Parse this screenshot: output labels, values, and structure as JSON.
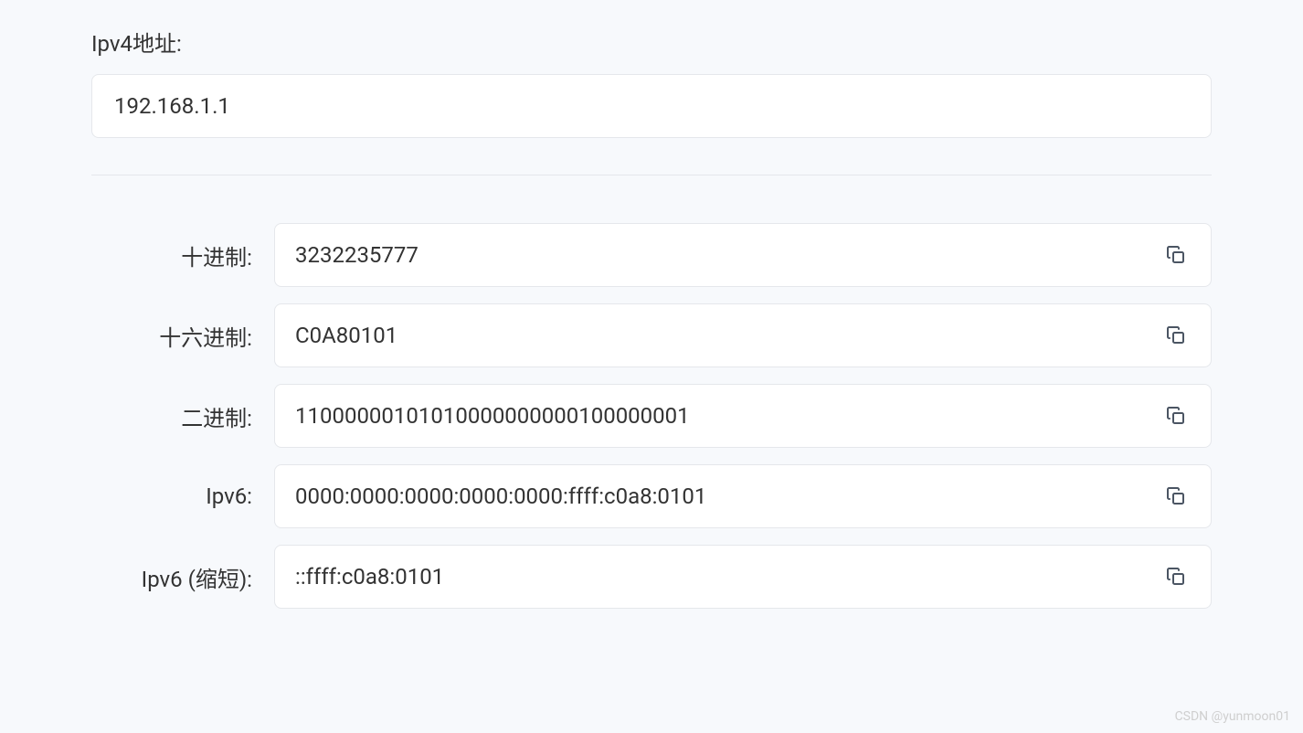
{
  "input": {
    "label": "Ipv4地址:",
    "value": "192.168.1.1"
  },
  "results": [
    {
      "label": "十进制:",
      "value": "3232235777"
    },
    {
      "label": "十六进制:",
      "value": "C0A80101"
    },
    {
      "label": "二进制:",
      "value": "11000000101010000000000100000001"
    },
    {
      "label": "Ipv6:",
      "value": "0000:0000:0000:0000:0000:ffff:c0a8:0101"
    },
    {
      "label": "Ipv6 (缩短):",
      "value": "::ffff:c0a8:0101"
    }
  ],
  "watermark": "CSDN @yunmoon01"
}
